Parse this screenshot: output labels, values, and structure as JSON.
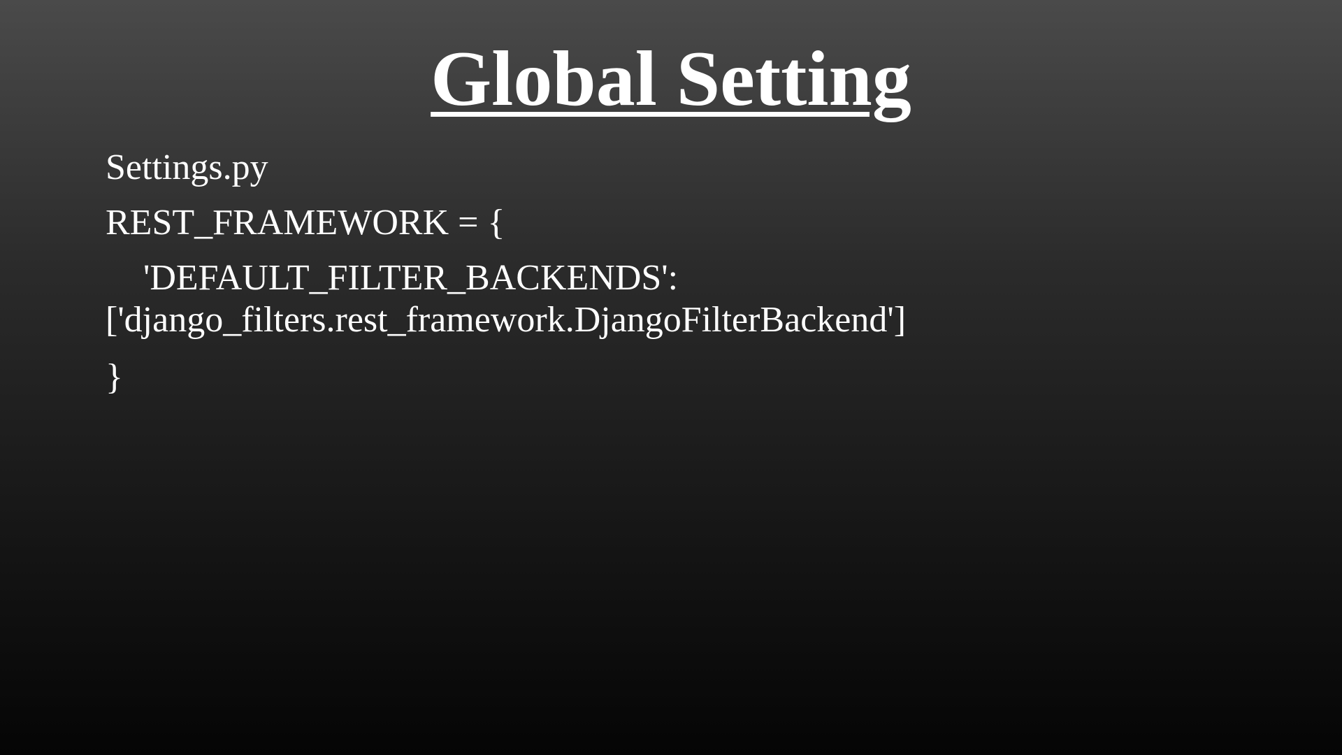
{
  "slide": {
    "title": "Global Setting",
    "lines": [
      "Settings.py",
      "REST_FRAMEWORK = {",
      "'DEFAULT_FILTER_BACKENDS':",
      "['django_filters.rest_framework.DjangoFilterBackend']",
      "}"
    ]
  }
}
